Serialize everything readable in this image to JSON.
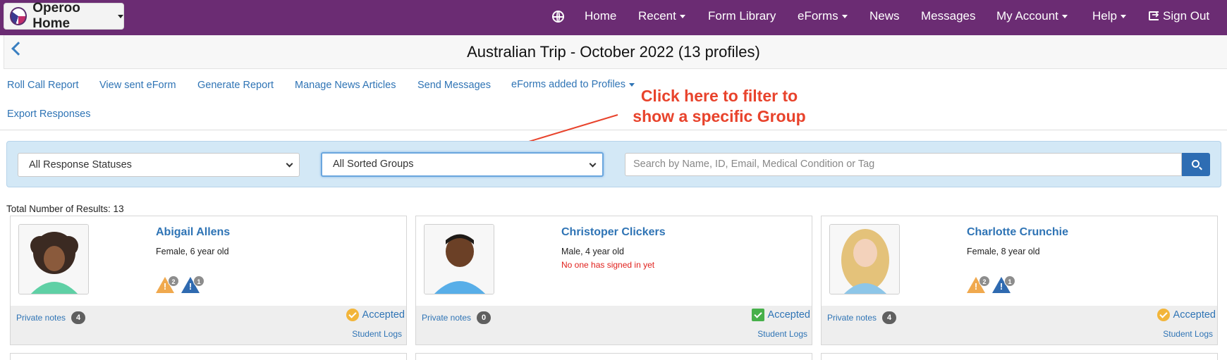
{
  "nav": {
    "brand": "Operoo Home",
    "items": [
      {
        "label": "Home",
        "dropdown": false
      },
      {
        "label": "Recent",
        "dropdown": true
      },
      {
        "label": "Form Library",
        "dropdown": false
      },
      {
        "label": "eForms",
        "dropdown": true
      },
      {
        "label": "News",
        "dropdown": false
      },
      {
        "label": "Messages",
        "dropdown": false
      },
      {
        "label": "My Account",
        "dropdown": true
      },
      {
        "label": "Help",
        "dropdown": true
      }
    ],
    "signout": "Sign Out",
    "colors": {
      "bar": "#6b2c73"
    }
  },
  "page": {
    "title": "Australian Trip - October 2022 (13 profiles)"
  },
  "actions": [
    "Roll Call Report",
    "View sent eForm",
    "Generate Report",
    "Manage News Articles",
    "Send Messages",
    "eForms added to Profiles",
    "Export Responses"
  ],
  "annotation": {
    "line1": "Click here to filter to",
    "line2": "show a specific Group",
    "color": "#e8432c"
  },
  "filters": {
    "status_select": "All Response Statuses",
    "group_select": "All Sorted Groups",
    "search_placeholder": "Search by Name, ID, Email, Medical Condition or Tag"
  },
  "results": {
    "total_label": "Total Number of Results: 13"
  },
  "profiles": [
    {
      "name": "Abigail Allens",
      "info": "Female, 6 year old",
      "warning": "",
      "alert_counts": [
        "2",
        "1"
      ],
      "notes_label": "Private notes",
      "notes_count": "4",
      "status": "Accepted",
      "status_icon": "check-circle-icon",
      "logs": "Student Logs"
    },
    {
      "name": "Christoper Clickers",
      "info": "Male, 4 year old",
      "warning": "No one has signed in yet",
      "alert_counts": [],
      "notes_label": "Private notes",
      "notes_count": "0",
      "status": "Accepted",
      "status_icon": "check-square-icon",
      "logs": "Student Logs"
    },
    {
      "name": "Charlotte Crunchie",
      "info": "Female, 8 year old",
      "warning": "",
      "alert_counts": [
        "2",
        "1"
      ],
      "notes_label": "Private notes",
      "notes_count": "4",
      "status": "Accepted",
      "status_icon": "check-circle-icon",
      "logs": "Student Logs"
    }
  ]
}
